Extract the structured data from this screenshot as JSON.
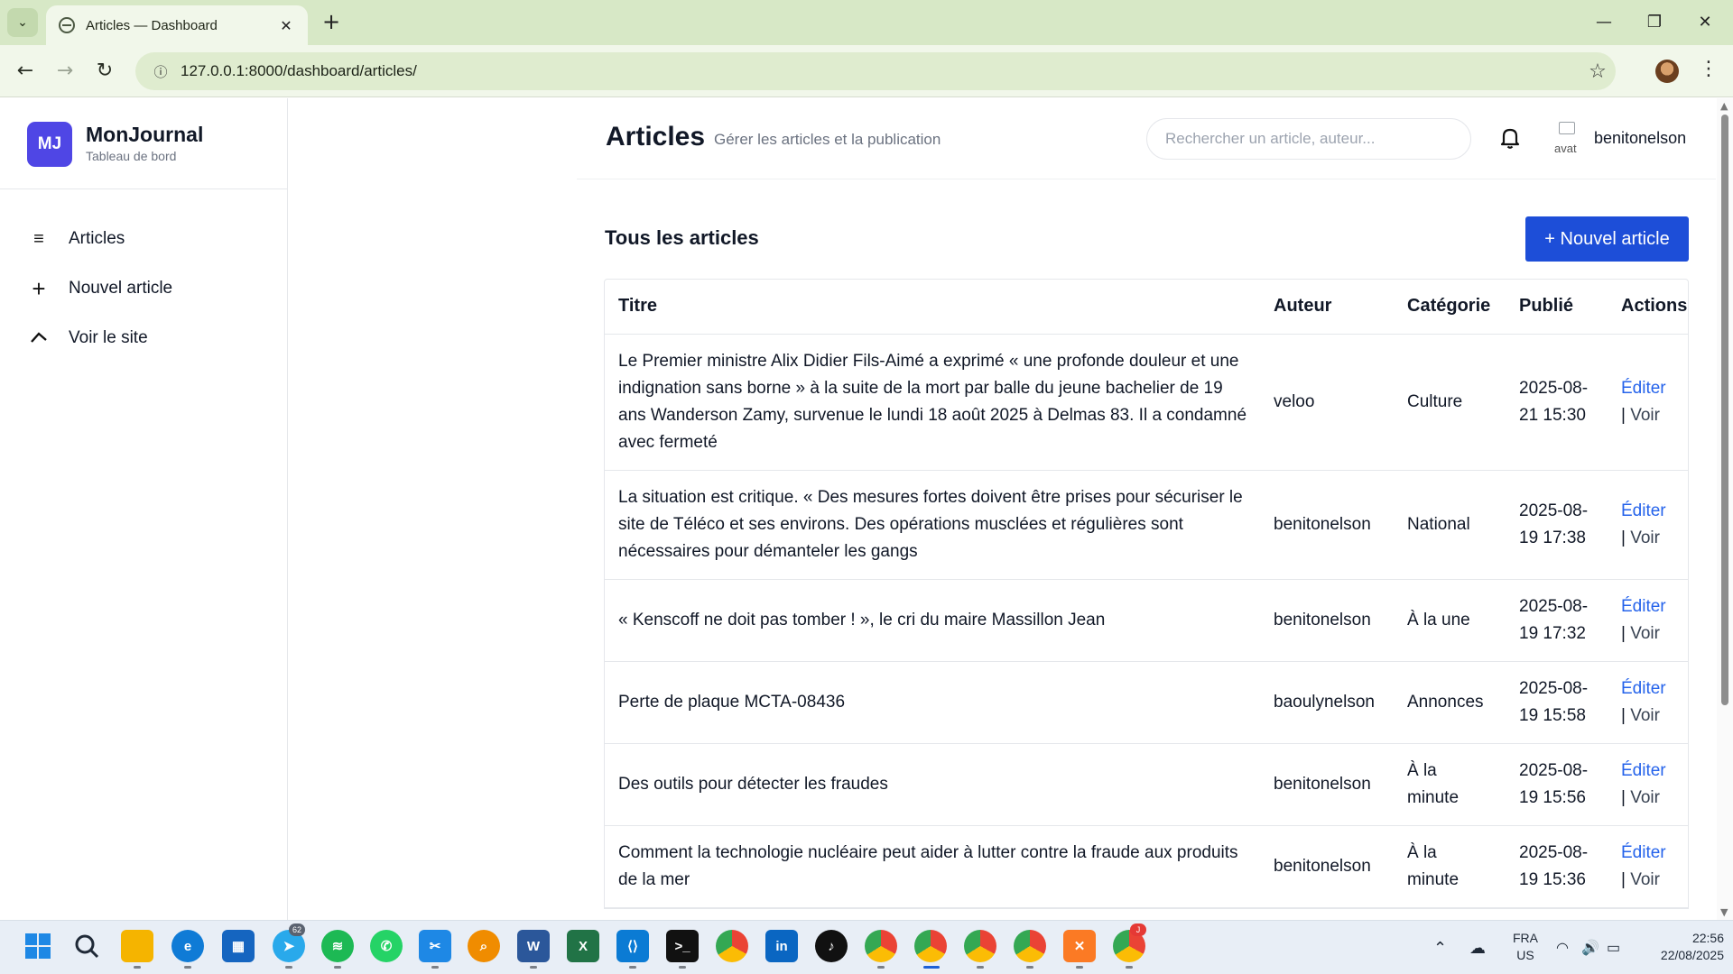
{
  "browser": {
    "tab_title": "Articles — Dashboard",
    "url": "127.0.0.1:8000/dashboard/articles/"
  },
  "sidebar": {
    "logo": "MJ",
    "brand_name": "MonJournal",
    "brand_sub": "Tableau de bord",
    "items": [
      {
        "label": "Articles",
        "icon": "list-icon"
      },
      {
        "label": "Nouvel article",
        "icon": "plus-icon"
      },
      {
        "label": "Voir le site",
        "icon": "external-link-icon"
      }
    ]
  },
  "header": {
    "title": "Articles",
    "subtitle": "Gérer les articles et la publication",
    "search_placeholder": "Rechercher un article, auteur...",
    "avatar_alt": "avat",
    "username": "benitonelson"
  },
  "main": {
    "section_title": "Tous les articles",
    "new_button": "+ Nouvel article",
    "columns": [
      "Titre",
      "Auteur",
      "Catégorie",
      "Publié",
      "Actions"
    ],
    "action_edit": "Éditer",
    "action_sep": "|",
    "action_view": "Voir",
    "rows": [
      {
        "title": "Le Premier ministre Alix Didier Fils-Aimé a exprimé « une profonde douleur et une indignation sans borne » à la suite de la mort par balle du jeune bachelier de 19 ans Wanderson Zamy, survenue le lundi 18 août 2025 à Delmas 83. Il a condamné avec fermeté",
        "author": "veloo",
        "category": "Culture",
        "published": "2025-08-21 15:30"
      },
      {
        "title": "La situation est critique. « Des mesures fortes doivent être prises pour sécuriser le site de Téléco et ses environs. Des opérations musclées et régulières sont nécessaires pour démanteler les gangs",
        "author": "benitonelson",
        "category": "National",
        "published": "2025-08-19 17:38"
      },
      {
        "title": "« Kenscoff ne doit pas tomber ! », le cri du maire Massillon Jean",
        "author": "benitonelson",
        "category": "À la une",
        "published": "2025-08-19 17:32"
      },
      {
        "title": "Perte de plaque MCTA-08436",
        "author": "baoulynelson",
        "category": "Annonces",
        "published": "2025-08-19 15:58"
      },
      {
        "title": "Des outils pour détecter les fraudes",
        "author": "benitonelson",
        "category": "À la minute",
        "published": "2025-08-19 15:56"
      },
      {
        "title": "Comment la technologie nucléaire peut aider à lutter contre la fraude aux produits de la mer",
        "author": "benitonelson",
        "category": "À la minute",
        "published": "2025-08-19 15:36"
      }
    ]
  },
  "taskbar": {
    "telegram_badge": "62",
    "chrome_badge": "J",
    "lang_line1": "FRA",
    "lang_line2": "US",
    "time": "22:56",
    "date": "22/08/2025"
  }
}
